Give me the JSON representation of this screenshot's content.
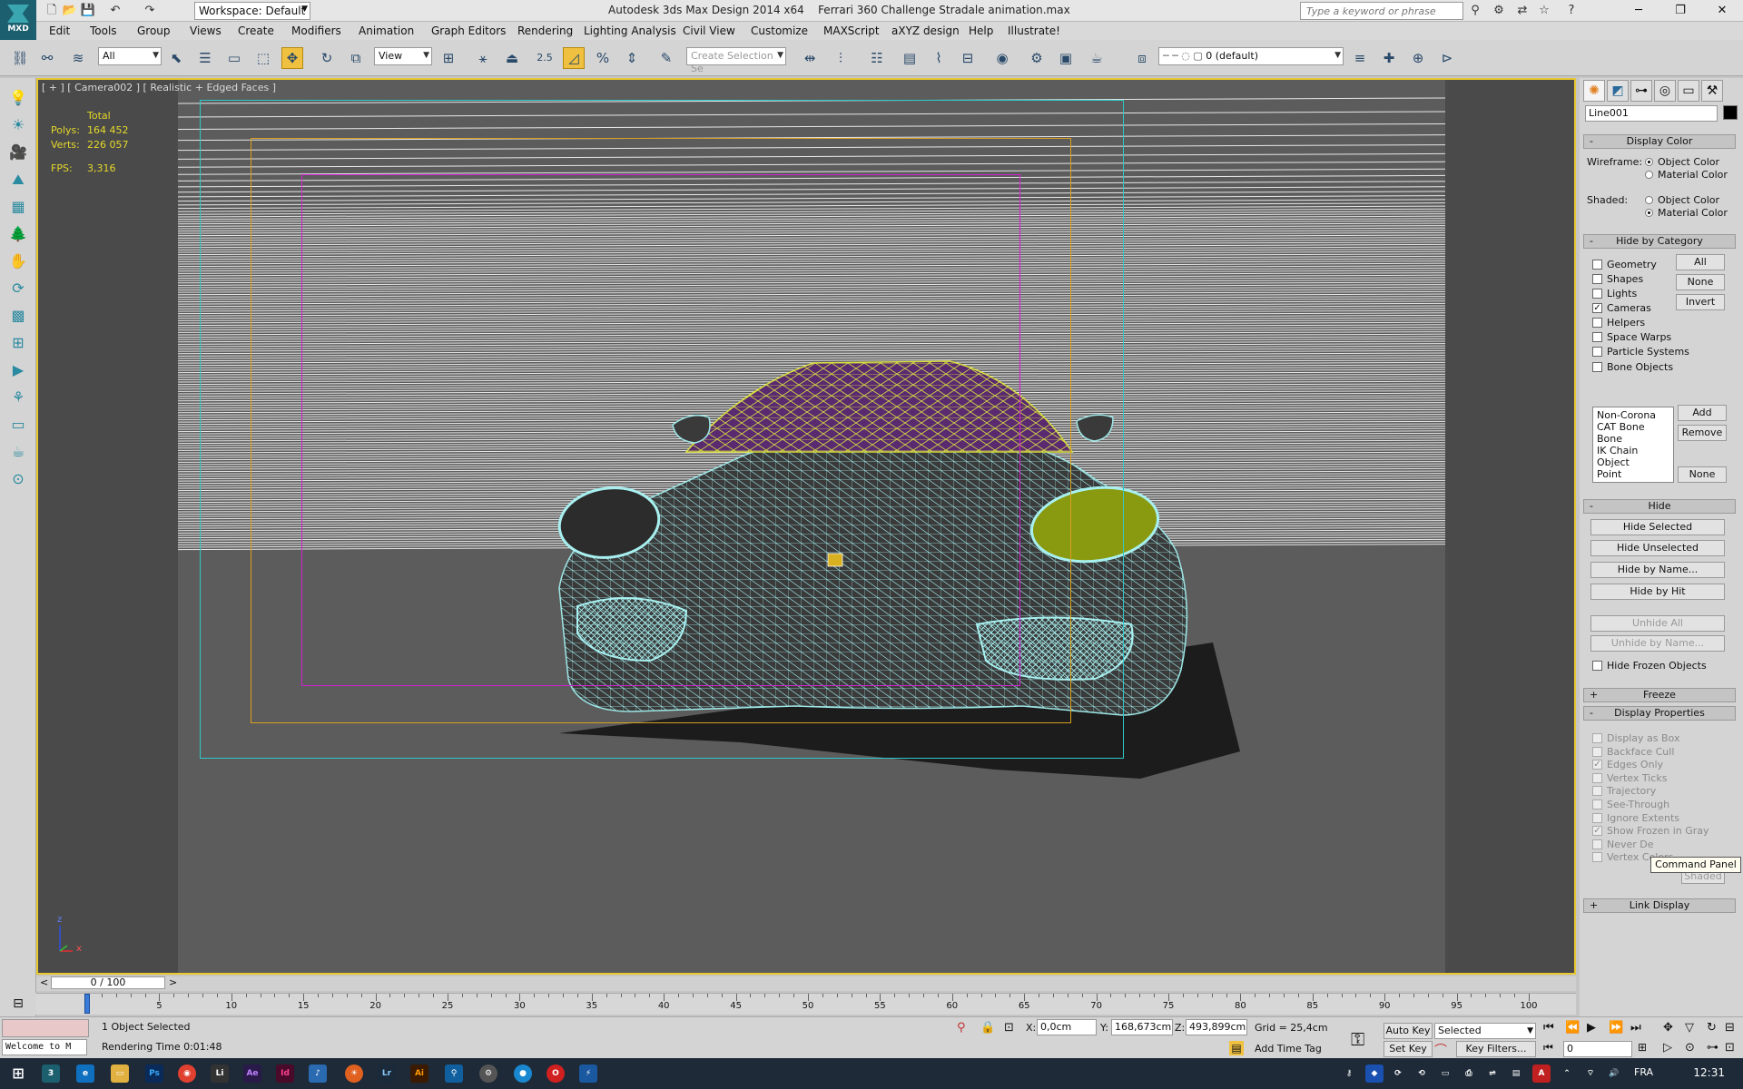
{
  "app": {
    "title_left": "Autodesk 3ds Max Design 2014 x64",
    "title_file": "Ferrari 360 Challenge Stradale animation.max",
    "logo_text": "MXD",
    "workspace_label": "Workspace: Default",
    "search_placeholder": "Type a keyword or phrase"
  },
  "menu": [
    "Edit",
    "Tools",
    "Group",
    "Views",
    "Create",
    "Modifiers",
    "Animation",
    "Graph Editors",
    "Rendering",
    "Lighting Analysis",
    "Civil View",
    "Customize",
    "MAXScript",
    "aXYZ design",
    "Help",
    "Illustrate!"
  ],
  "toolbar": {
    "filter_value": "All",
    "refcoord_value": "View",
    "spinner_snap": "2.5",
    "selection_set_placeholder": "Create Selection Se",
    "layer_value": "0 (default)"
  },
  "viewport": {
    "label": "[ + ] [ Camera002 ] [ Realistic + Edged Faces ]",
    "stats_title": "Total",
    "polys_label": "Polys:",
    "polys_value": "164 452",
    "verts_label": "Verts:",
    "verts_value": "226 057",
    "fps_label": "FPS:",
    "fps_value": "3,316",
    "axis_z": "z",
    "axis_x": "x"
  },
  "panel": {
    "object_name": "Line001",
    "object_color": "#000000",
    "display_color": {
      "header": "Display Color",
      "wireframe_label": "Wireframe:",
      "shaded_label": "Shaded:",
      "object_color": "Object Color",
      "material_color": "Material Color"
    },
    "hide_by_category": {
      "header": "Hide by Category",
      "items": [
        {
          "label": "Geometry",
          "checked": false
        },
        {
          "label": "Shapes",
          "checked": false
        },
        {
          "label": "Lights",
          "checked": false
        },
        {
          "label": "Cameras",
          "checked": true
        },
        {
          "label": "Helpers",
          "checked": false
        },
        {
          "label": "Space Warps",
          "checked": false
        },
        {
          "label": "Particle Systems",
          "checked": false
        },
        {
          "label": "Bone Objects",
          "checked": false
        }
      ],
      "btn_all": "All",
      "btn_none": "None",
      "btn_invert": "Invert",
      "list": [
        "Non-Corona",
        "CAT Bone",
        "Bone",
        "IK Chain Object",
        "Point"
      ],
      "btn_add": "Add",
      "btn_remove": "Remove",
      "btn_none2": "None"
    },
    "hide": {
      "header": "Hide",
      "buttons": [
        "Hide Selected",
        "Hide Unselected",
        "Hide by Name...",
        "Hide by Hit"
      ],
      "disabled_buttons": [
        "Unhide All",
        "Unhide by Name..."
      ],
      "hide_frozen": "Hide Frozen Objects"
    },
    "freeze": {
      "header": "Freeze"
    },
    "display_properties": {
      "header": "Display Properties",
      "items": [
        {
          "label": "Display as Box",
          "checked": false
        },
        {
          "label": "Backface Cull",
          "checked": false
        },
        {
          "label": "Edges Only",
          "checked": true
        },
        {
          "label": "Vertex Ticks",
          "checked": false
        },
        {
          "label": "Trajectory",
          "checked": false
        },
        {
          "label": "See-Through",
          "checked": false
        },
        {
          "label": "Ignore Extents",
          "checked": false
        },
        {
          "label": "Show Frozen in Gray",
          "checked": true
        },
        {
          "label": "Never De",
          "checked": false
        },
        {
          "label": "Vertex Colors",
          "checked": false
        }
      ],
      "shaded_btn": "Shaded"
    },
    "link_display": {
      "header": "Link Display"
    },
    "tooltip": "Command Panel"
  },
  "timeline": {
    "slider_label": "0 / 100",
    "current_frame": 0,
    "max_frame": 100,
    "ticks": [
      5,
      10,
      15,
      20,
      25,
      30,
      35,
      40,
      45,
      50,
      55,
      60,
      65,
      70,
      75,
      80,
      85,
      90,
      95,
      100
    ]
  },
  "status": {
    "selection": "1 Object Selected",
    "rendering_time": "Rendering Time  0:01:48",
    "maxscript": "Welcome to M",
    "x_label": "X:",
    "x_value": "0,0cm",
    "y_label": "Y:",
    "y_value": "168,673cm",
    "z_label": "Z:",
    "z_value": "493,899cm",
    "grid": "Grid = 25,4cm",
    "add_time_tag": "Add Time Tag",
    "auto_key": "Auto Key",
    "set_key": "Set Key",
    "selected_combo": "Selected",
    "key_filters": "Key Filters...",
    "frame_value": "0"
  },
  "taskbar": {
    "lang": "FRA",
    "time": "12:31"
  }
}
